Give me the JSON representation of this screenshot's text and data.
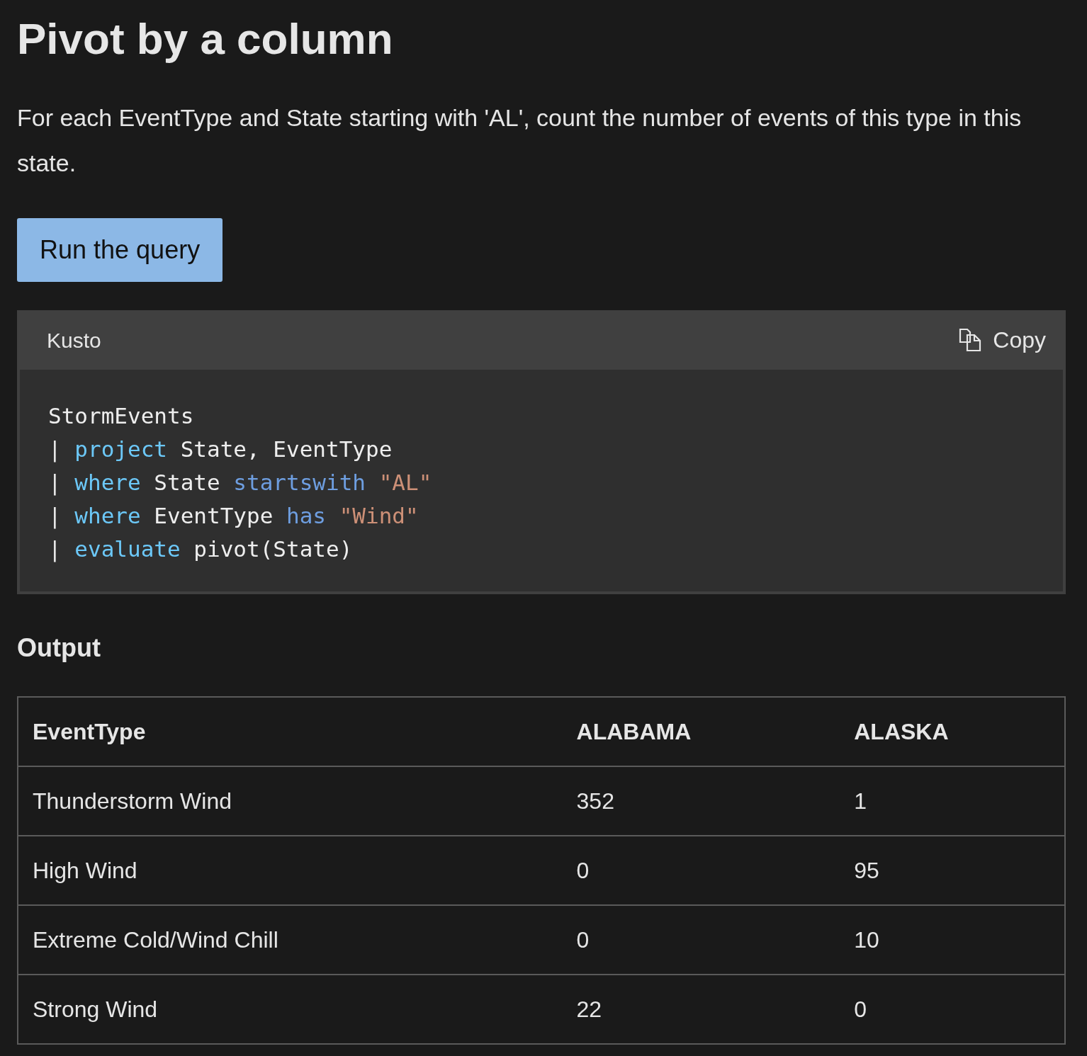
{
  "heading": "Pivot by a column",
  "description": "For each EventType and State starting with 'AL', count the number of events of this type in this state.",
  "run_button": "Run the query",
  "code_block": {
    "language": "Kusto",
    "copy_label": "Copy",
    "lines": [
      [
        {
          "kind": "plain",
          "text": "StormEvents"
        }
      ],
      [
        {
          "kind": "pipe",
          "text": "|"
        },
        {
          "kind": "keyword",
          "text": "project"
        },
        {
          "kind": "plain",
          "text": "State, EventType"
        }
      ],
      [
        {
          "kind": "pipe",
          "text": "|"
        },
        {
          "kind": "keyword",
          "text": "where"
        },
        {
          "kind": "plain",
          "text": "State"
        },
        {
          "kind": "operator",
          "text": "startswith"
        },
        {
          "kind": "string",
          "text": "\"AL\""
        }
      ],
      [
        {
          "kind": "pipe",
          "text": "|"
        },
        {
          "kind": "keyword",
          "text": "where"
        },
        {
          "kind": "plain",
          "text": "EventType"
        },
        {
          "kind": "operator",
          "text": "has"
        },
        {
          "kind": "string",
          "text": "\"Wind\""
        }
      ],
      [
        {
          "kind": "pipe",
          "text": "|"
        },
        {
          "kind": "keyword",
          "text": "evaluate"
        },
        {
          "kind": "plain",
          "text": "pivot(State)"
        }
      ]
    ]
  },
  "output_heading": "Output",
  "table": {
    "columns": [
      "EventType",
      "ALABAMA",
      "ALASKA"
    ],
    "rows": [
      [
        "Thunderstorm Wind",
        "352",
        "1"
      ],
      [
        "High Wind",
        "0",
        "95"
      ],
      [
        "Extreme Cold/Wind Chill",
        "0",
        "10"
      ],
      [
        "Strong Wind",
        "22",
        "0"
      ]
    ]
  }
}
